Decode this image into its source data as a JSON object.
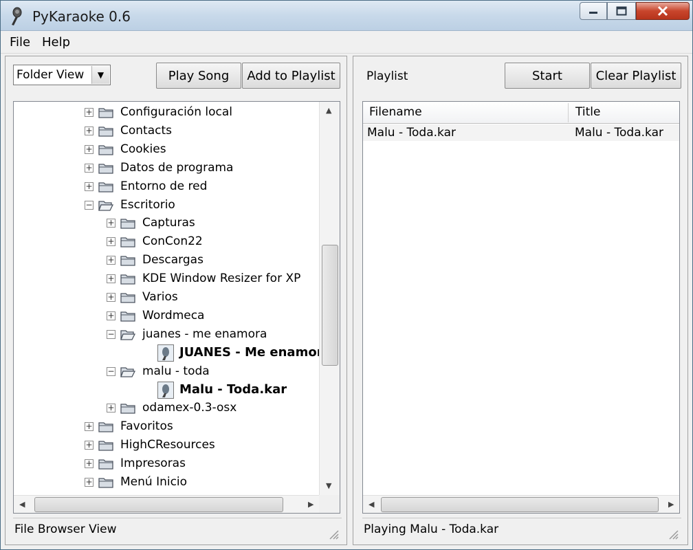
{
  "window": {
    "title": "PyKaraoke 0.6"
  },
  "menu": {
    "file": "File",
    "help": "Help"
  },
  "browser": {
    "view_select": "Folder View",
    "play_button": "Play Song",
    "add_button": "Add to Playlist",
    "status": "File Browser View",
    "tree": [
      {
        "label": "Configuración local",
        "level": 0,
        "kind": "folder",
        "expander": "+"
      },
      {
        "label": "Contacts",
        "level": 0,
        "kind": "folder",
        "expander": "+"
      },
      {
        "label": "Cookies",
        "level": 0,
        "kind": "folder",
        "expander": "+"
      },
      {
        "label": "Datos de programa",
        "level": 0,
        "kind": "folder",
        "expander": "+"
      },
      {
        "label": "Entorno de red",
        "level": 0,
        "kind": "folder",
        "expander": "+"
      },
      {
        "label": "Escritorio",
        "level": 0,
        "kind": "folder-open",
        "expander": "−"
      },
      {
        "label": "Capturas",
        "level": 1,
        "kind": "folder",
        "expander": "+"
      },
      {
        "label": "ConCon22",
        "level": 1,
        "kind": "folder",
        "expander": "+"
      },
      {
        "label": "Descargas",
        "level": 1,
        "kind": "folder",
        "expander": "+"
      },
      {
        "label": "KDE Window Resizer for XP",
        "level": 1,
        "kind": "folder",
        "expander": "+"
      },
      {
        "label": "Varios",
        "level": 1,
        "kind": "folder",
        "expander": "+"
      },
      {
        "label": "Wordmeca",
        "level": 1,
        "kind": "folder",
        "expander": "+"
      },
      {
        "label": "juanes - me enamora",
        "level": 1,
        "kind": "folder-open",
        "expander": "−"
      },
      {
        "label": "JUANES - Me enamora.kar",
        "level": 2,
        "kind": "file",
        "expander": ""
      },
      {
        "label": "malu - toda",
        "level": 1,
        "kind": "folder-open",
        "expander": "−"
      },
      {
        "label": "Malu - Toda.kar",
        "level": 2,
        "kind": "file",
        "expander": ""
      },
      {
        "label": "odamex-0.3-osx",
        "level": 1,
        "kind": "folder",
        "expander": "+"
      },
      {
        "label": "Favoritos",
        "level": 0,
        "kind": "folder",
        "expander": "+"
      },
      {
        "label": "HighCResources",
        "level": 0,
        "kind": "folder",
        "expander": "+"
      },
      {
        "label": "Impresoras",
        "level": 0,
        "kind": "folder",
        "expander": "+"
      },
      {
        "label": "Menú Inicio",
        "level": 0,
        "kind": "folder",
        "expander": "+"
      }
    ]
  },
  "playlist": {
    "label": "Playlist",
    "start_button": "Start",
    "clear_button": "Clear Playlist",
    "columns": [
      "Filename",
      "Title"
    ],
    "rows": [
      {
        "filename": "Malu - Toda.kar",
        "title": "Malu - Toda.kar"
      }
    ],
    "status": "Playing Malu - Toda.kar"
  }
}
